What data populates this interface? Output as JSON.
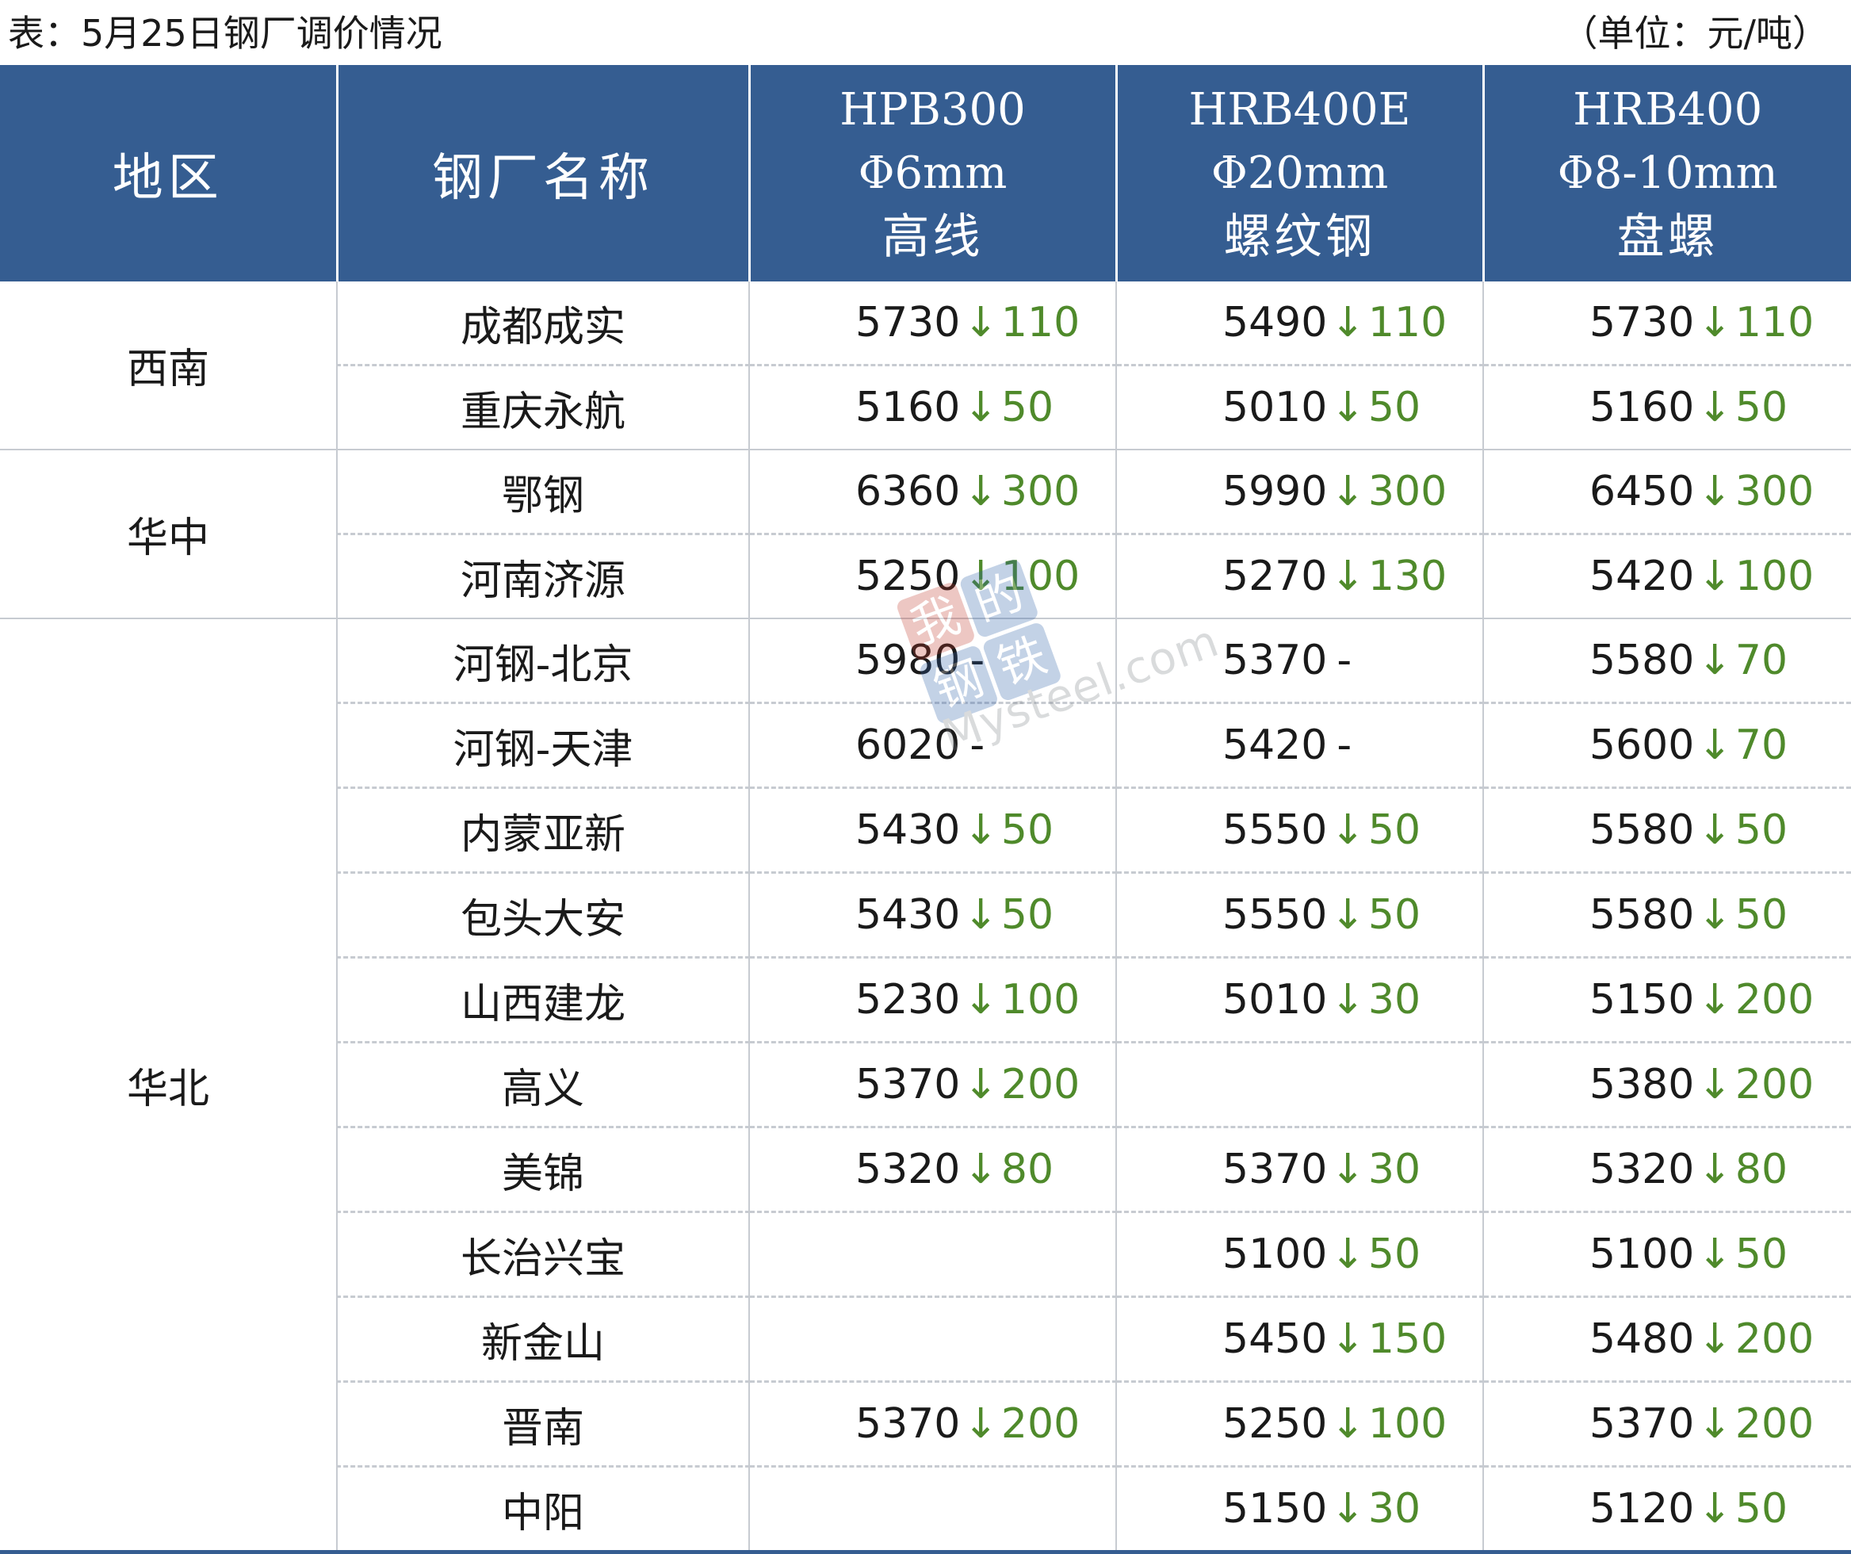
{
  "caption": {
    "title": "表：5月25日钢厂调价情况",
    "unit": "（单位：元/吨）"
  },
  "header": {
    "region": "地区",
    "mill": "钢厂名称",
    "hpb300": [
      "HPB300",
      "Φ6mm",
      "高线"
    ],
    "hrb400e": [
      "HRB400E",
      "Φ20mm",
      "螺纹钢"
    ],
    "hrb400": [
      "HRB400",
      "Φ8-10mm",
      "盘螺"
    ]
  },
  "colors": {
    "header_bg": "#355d91",
    "down_arrow": "#4f8a2b"
  },
  "regions": [
    {
      "name": "西南",
      "rowspan": 2
    },
    {
      "name": "华中",
      "rowspan": 2
    },
    {
      "name": "华北",
      "rowspan": 11
    }
  ],
  "rows": [
    {
      "mill": "成都成实",
      "hpb300": {
        "price": "5730",
        "change": "110"
      },
      "hrb400e": {
        "price": "5490",
        "change": "110"
      },
      "hrb400": {
        "price": "5730",
        "change": "110"
      }
    },
    {
      "mill": "重庆永航",
      "hpb300": {
        "price": "5160",
        "change": "50"
      },
      "hrb400e": {
        "price": "5010",
        "change": "50"
      },
      "hrb400": {
        "price": "5160",
        "change": "50"
      }
    },
    {
      "mill": "鄂钢",
      "hpb300": {
        "price": "6360",
        "change": "300"
      },
      "hrb400e": {
        "price": "5990",
        "change": "300"
      },
      "hrb400": {
        "price": "6450",
        "change": "300"
      }
    },
    {
      "mill": "河南济源",
      "hpb300": {
        "price": "5250",
        "change": "100"
      },
      "hrb400e": {
        "price": "5270",
        "change": "130"
      },
      "hrb400": {
        "price": "5420",
        "change": "100"
      }
    },
    {
      "mill": "河钢-北京",
      "hpb300": {
        "price": "5980",
        "change": "-"
      },
      "hrb400e": {
        "price": "5370",
        "change": "-"
      },
      "hrb400": {
        "price": "5580",
        "change": "70"
      }
    },
    {
      "mill": "河钢-天津",
      "hpb300": {
        "price": "6020",
        "change": "-"
      },
      "hrb400e": {
        "price": "5420",
        "change": "-"
      },
      "hrb400": {
        "price": "5600",
        "change": "70"
      }
    },
    {
      "mill": "内蒙亚新",
      "hpb300": {
        "price": "5430",
        "change": "50"
      },
      "hrb400e": {
        "price": "5550",
        "change": "50"
      },
      "hrb400": {
        "price": "5580",
        "change": "50"
      }
    },
    {
      "mill": "包头大安",
      "hpb300": {
        "price": "5430",
        "change": "50"
      },
      "hrb400e": {
        "price": "5550",
        "change": "50"
      },
      "hrb400": {
        "price": "5580",
        "change": "50"
      }
    },
    {
      "mill": "山西建龙",
      "hpb300": {
        "price": "5230",
        "change": "100"
      },
      "hrb400e": {
        "price": "5010",
        "change": "30"
      },
      "hrb400": {
        "price": "5150",
        "change": "200"
      }
    },
    {
      "mill": "高义",
      "hpb300": {
        "price": "5370",
        "change": "200"
      },
      "hrb400e": null,
      "hrb400": {
        "price": "5380",
        "change": "200"
      }
    },
    {
      "mill": "美锦",
      "hpb300": {
        "price": "5320",
        "change": "80"
      },
      "hrb400e": {
        "price": "5370",
        "change": "30"
      },
      "hrb400": {
        "price": "5320",
        "change": "80"
      }
    },
    {
      "mill": "长治兴宝",
      "hpb300": null,
      "hrb400e": {
        "price": "5100",
        "change": "50"
      },
      "hrb400": {
        "price": "5100",
        "change": "50"
      }
    },
    {
      "mill": "新金山",
      "hpb300": null,
      "hrb400e": {
        "price": "5450",
        "change": "150"
      },
      "hrb400": {
        "price": "5480",
        "change": "200"
      }
    },
    {
      "mill": "晋南",
      "hpb300": {
        "price": "5370",
        "change": "200"
      },
      "hrb400e": {
        "price": "5250",
        "change": "100"
      },
      "hrb400": {
        "price": "5370",
        "change": "200"
      }
    },
    {
      "mill": "中阳",
      "hpb300": null,
      "hrb400e": {
        "price": "5150",
        "change": "30"
      },
      "hrb400": {
        "price": "5120",
        "change": "50"
      }
    }
  ],
  "watermark": {
    "glyphs": [
      "我",
      "的",
      "钢",
      "铁"
    ],
    "text": "Mysteel.com"
  }
}
